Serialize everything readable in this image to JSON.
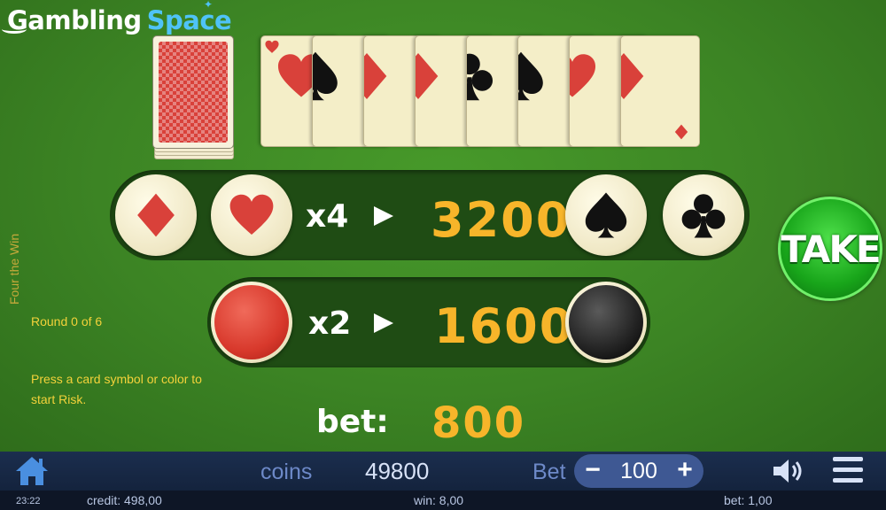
{
  "brand": {
    "part1": "Gambling",
    "part2": "Space"
  },
  "game": {
    "side_title": "Four the Win",
    "round": "Round 0 of 6",
    "hint": "Press a card symbol or color to start Risk."
  },
  "history_cards": [
    {
      "suit": "hearts",
      "color": "#d9413a"
    },
    {
      "suit": "spades",
      "color": "#111111"
    },
    {
      "suit": "diamonds",
      "color": "#d9413a"
    },
    {
      "suit": "diamonds",
      "color": "#d9413a"
    },
    {
      "suit": "clubs",
      "color": "#111111"
    },
    {
      "suit": "spades",
      "color": "#111111"
    },
    {
      "suit": "hearts",
      "color": "#d9413a"
    },
    {
      "suit": "diamonds",
      "color": "#d9413a"
    }
  ],
  "suit_bet": {
    "multiplier": "x4",
    "value": "3200"
  },
  "color_bet": {
    "multiplier": "x2",
    "value": "1600"
  },
  "take_label": "TAKE",
  "bet": {
    "label": "bet:",
    "value": "800"
  },
  "toolbar": {
    "coins_label": "coins",
    "coins_value": "49800",
    "bet_label": "Bet",
    "bet_value": "100",
    "minus": "−",
    "plus": "+"
  },
  "status": {
    "clock": "23:22",
    "credit": "credit: 498,00",
    "win": "win: 8,00",
    "bet": "bet: 1,00"
  },
  "colors": {
    "accent": "#f7b52a",
    "hint": "#f3d23a",
    "felt": "#3c8424",
    "red": "#d9413a"
  }
}
